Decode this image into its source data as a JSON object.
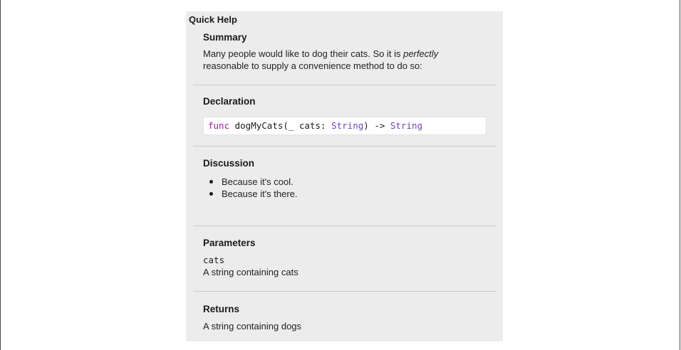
{
  "quick_help": {
    "title": "Quick Help",
    "summary": {
      "heading": "Summary",
      "text_before": "Many people would like to dog their cats. So it is ",
      "text_emphasis": "perfectly",
      "text_line2": "reasonable to supply a convenience method to do so:"
    },
    "declaration": {
      "heading": "Declaration",
      "code_keyword": "func",
      "code_name": " dogMyCats(_ cats: ",
      "code_param_type": "String",
      "code_arrow": ") -> ",
      "code_return_type": "String"
    },
    "discussion": {
      "heading": "Discussion",
      "items": [
        "Because it's cool.",
        "Because it's there."
      ]
    },
    "parameters": {
      "heading": "Parameters",
      "name": "cats",
      "description": "A string containing cats"
    },
    "returns": {
      "heading": "Returns",
      "text": "A string containing dogs"
    }
  },
  "colors": {
    "panel_background": "#ececec",
    "keyword": "#9b2393",
    "type": "#6f41c1"
  }
}
